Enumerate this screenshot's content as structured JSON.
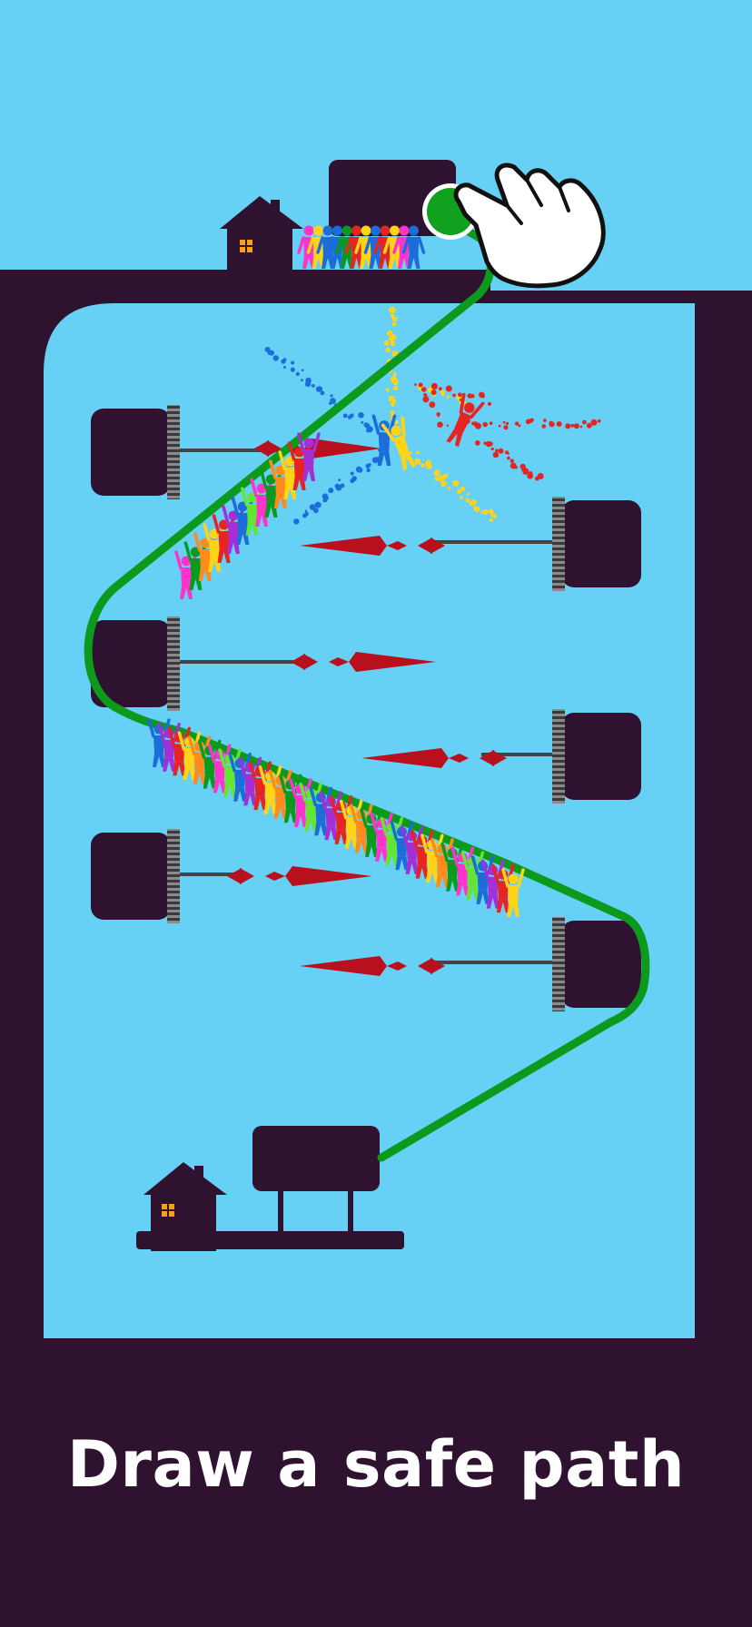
{
  "caption": {
    "text": "Draw a safe path"
  },
  "icons": {
    "hand": "pointing-hand-icon",
    "start": "start-node-icon",
    "house": "house-icon"
  },
  "colors": {
    "sky": "#67d0f5",
    "ground": "#2f1230",
    "path": "#0c9a1d",
    "spike": "#b8101c",
    "start_node": "#12a11f",
    "caption": "#ffffff"
  },
  "people_palette": [
    "#ff33cc",
    "#ffd416",
    "#1c6dd8",
    "#0c9a1d",
    "#e62424",
    "#62e630",
    "#ff8a1e",
    "#a52fd6"
  ]
}
